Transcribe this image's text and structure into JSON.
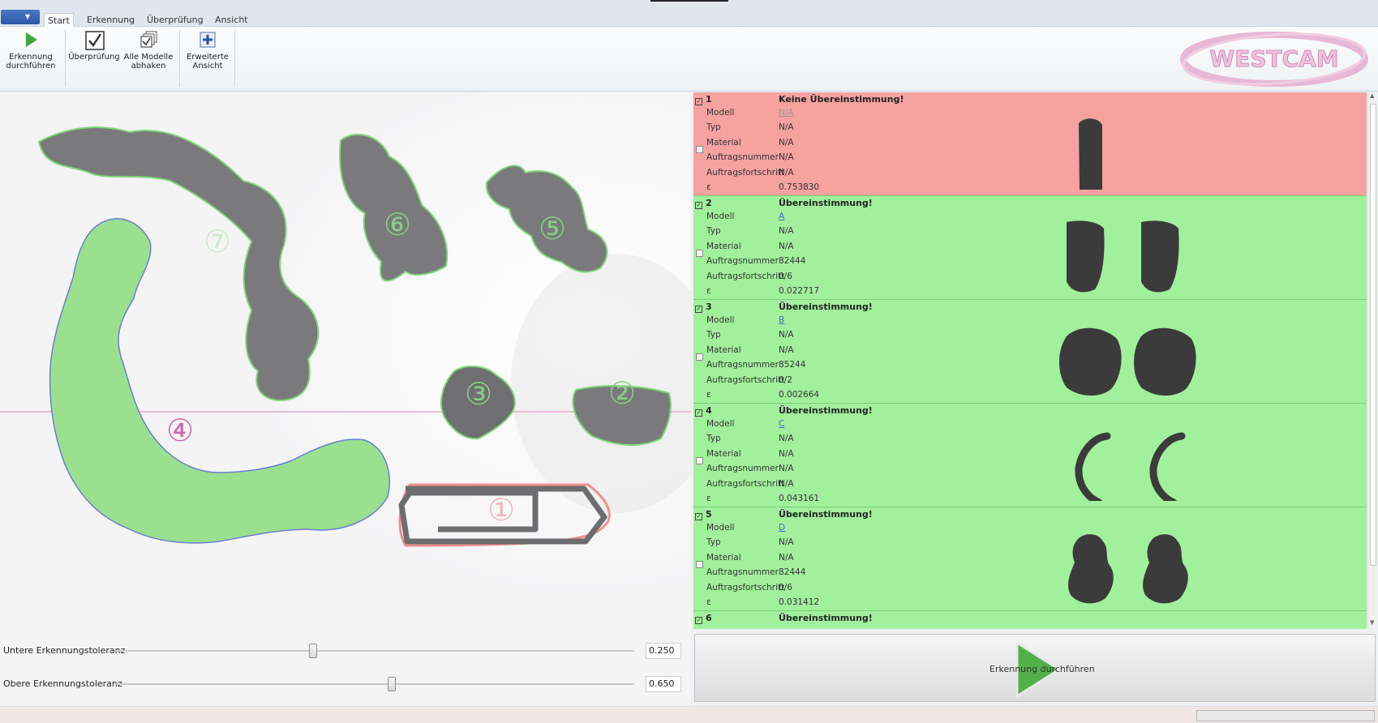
{
  "ribbon": {
    "tabs": [
      "Start",
      "Erkennung",
      "Überprüfung",
      "Ansicht"
    ],
    "buttons": {
      "run": "Erkennung durchführen",
      "check": "Überprüfung",
      "check_all": "Alle Modelle abhaken",
      "advanced": "Erweiterte Ansicht"
    },
    "logo_text": "WESTCAM"
  },
  "canvas": {
    "labels": [
      "①",
      "②",
      "③",
      "④",
      "⑤",
      "⑥",
      "⑦"
    ]
  },
  "sliders": {
    "lower": {
      "label": "Untere Erkennungstoleranz",
      "value": "0.250",
      "level": 0.35
    },
    "upper": {
      "label": "Obere Erkennungstoleranz",
      "value": "0.650",
      "level": 0.49
    }
  },
  "fields": {
    "model": "Modell",
    "type": "Typ",
    "material": "Material",
    "order": "Auftragsnummer",
    "progress": "Auftragsfortschritt",
    "eps": "ε"
  },
  "results": [
    {
      "num": "1",
      "status": "Keine Übereinstimmung!",
      "model": "N/A",
      "type": "N/A",
      "material": "N/A",
      "order": "N/A",
      "progress": "N/A",
      "eps": "0.753830",
      "ok": false
    },
    {
      "num": "2",
      "status": "Übereinstimmung!",
      "model": "A",
      "type": "N/A",
      "material": "N/A",
      "order": "82444",
      "progress": "0/6",
      "eps": "0.022717",
      "ok": true
    },
    {
      "num": "3",
      "status": "Übereinstimmung!",
      "model": "B",
      "type": "N/A",
      "material": "N/A",
      "order": "85244",
      "progress": "0/2",
      "eps": "0.002664",
      "ok": true
    },
    {
      "num": "4",
      "status": "Übereinstimmung!",
      "model": "C",
      "type": "N/A",
      "material": "N/A",
      "order": "N/A",
      "progress": "N/A",
      "eps": "0.043161",
      "ok": true
    },
    {
      "num": "5",
      "status": "Übereinstimmung!",
      "model": "D",
      "type": "N/A",
      "material": "N/A",
      "order": "82444",
      "progress": "0/6",
      "eps": "0.031412",
      "ok": true
    },
    {
      "num": "6",
      "status": "Übereinstimmung!",
      "ok": true
    }
  ],
  "run_button": "Erkennung durchführen",
  "colors": {
    "match": "#a1f09c",
    "no_match": "#f6a2a1",
    "outline_green": "#7fd67a",
    "outline_red": "#f08f8f",
    "accent_pink": "#d06aa8"
  }
}
